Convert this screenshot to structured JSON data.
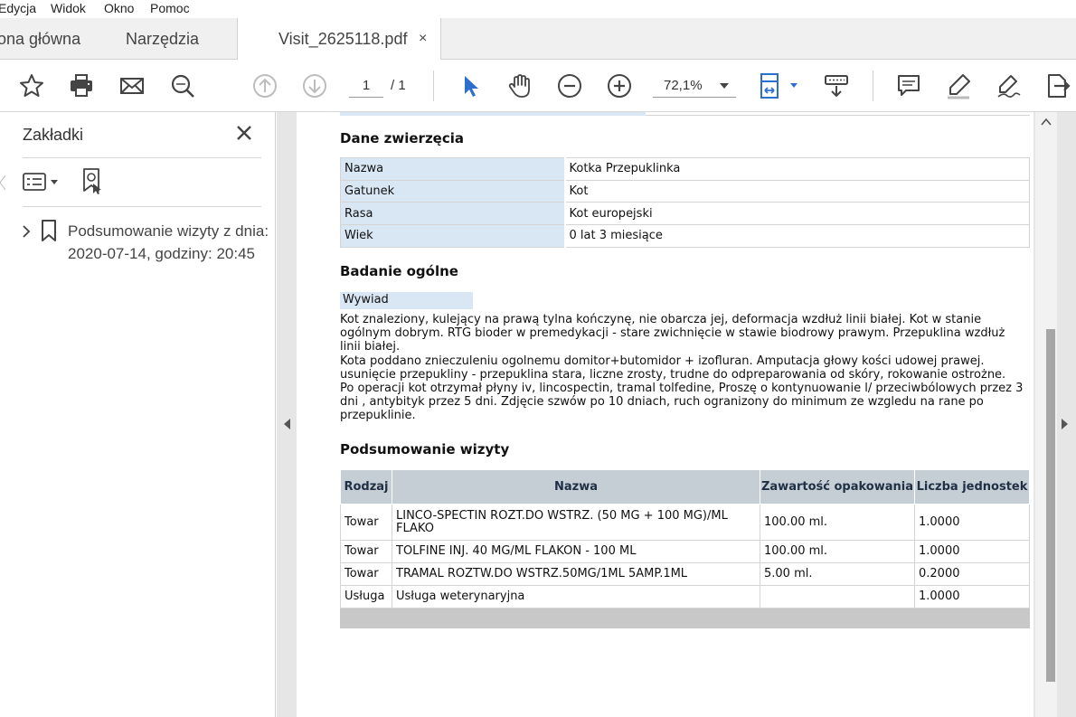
{
  "menu": {
    "items": [
      "Edycja",
      "Widok",
      "Okno",
      "Pomoc"
    ]
  },
  "tabs": {
    "home": "ona główna",
    "tools": "Narzędzia",
    "file": "Visit_2625118.pdf",
    "close": "×"
  },
  "toolbar": {
    "page_current": "1",
    "page_total": "/ 1",
    "zoom": "72,1%"
  },
  "sidebar": {
    "title": "Zakładki",
    "bookmark": "Podsumowanie wizyty z dnia: 2020-07-14, godziny: 20:45"
  },
  "document": {
    "animal_heading": "Dane zwierzęcia",
    "animal_rows": [
      {
        "label": "Nazwa",
        "value": "Kotka Przepuklinka"
      },
      {
        "label": "Gatunek",
        "value": "Kot"
      },
      {
        "label": "Rasa",
        "value": "Kot europejski"
      },
      {
        "label": "Wiek",
        "value": "0 lat 3 miesiące"
      }
    ],
    "exam_heading": "Badanie ogólne",
    "interview_label": "Wywiad",
    "notes": [
      "Kot znaleziony, kulejący na prawą tylna kończynę, nie obarcza jej, deformacja wzdłuż linii białej. Kot w stanie ogólnym dobrym. RTG bioder w premedykacji - stare zwichnięcie w stawie biodrowy prawym. Przepuklina wzdłuż linii białej.",
      "Kota poddano znieczuleniu ogolnemu domitor+butomidor + izofluran. Amputacja głowy kości udowej prawej.",
      "usunięcie przepukliny - przepuklina stara, liczne zrosty, trudne do odpreparowania od skóry, rokowanie ostrożne.",
      "Po operacji kot otrzymał płyny iv, lincospectin, tramal tolfedine, Proszę o kontynuowanie l/ przeciwbólowych przez 3 dni , antybityk przez 5 dni. Zdjęcie szwów po 10 dniach, ruch ogranizony do minimum ze wzgledu na rane po przepuklinie."
    ],
    "summary_heading": "Podsumowanie wizyty",
    "summary_headers": [
      "Rodzaj",
      "Nazwa",
      "Zawartość opakowania",
      "Liczba jednostek"
    ],
    "summary_rows": [
      [
        "Towar",
        "LINCO-SPECTIN ROZT.DO WSTRZ. (50 MG + 100 MG)/ML FLAKO",
        "100.00 ml.",
        "1.0000"
      ],
      [
        "Towar",
        "TOLFINE INJ. 40 MG/ML FLAKON - 100 ML",
        "100.00 ml.",
        "1.0000"
      ],
      [
        "Towar",
        "TRAMAL ROZTW.DO WSTRZ.50MG/1ML 5AMP.1ML",
        "5.00 ml.",
        "0.2000"
      ],
      [
        "Usługa",
        "Usługa weterynaryjna",
        "",
        "1.0000"
      ]
    ]
  },
  "colors": {
    "accent_blue": "#2d6fce",
    "cell_blue": "#d9e6f3",
    "header_gray": "#c6ced5"
  }
}
